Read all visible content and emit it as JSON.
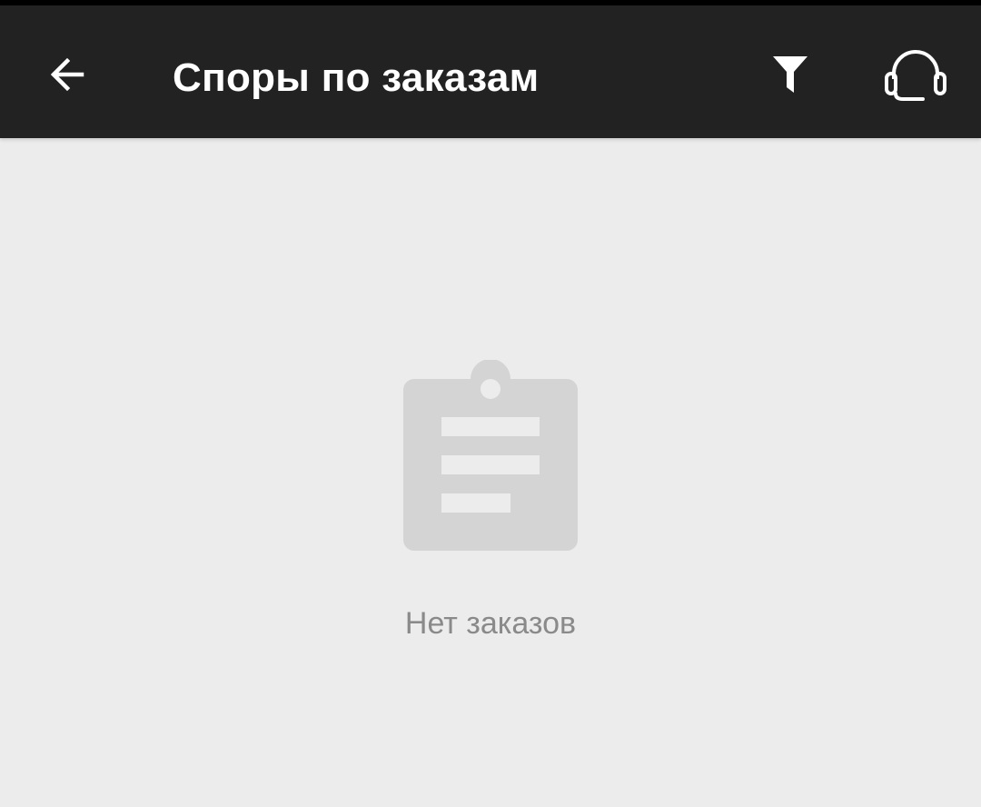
{
  "app_bar": {
    "title": "Споры по заказам",
    "back_icon": "arrow-left-icon",
    "filter_icon": "filter-icon",
    "support_icon": "headset-icon",
    "background_color": "#222222",
    "foreground_color": "#ffffff"
  },
  "empty_state": {
    "icon": "clipboard-icon",
    "message": "Нет заказов",
    "icon_color": "#d4d4d4",
    "text_color": "#8a8a8a"
  },
  "colors": {
    "page_background": "#ececec"
  }
}
